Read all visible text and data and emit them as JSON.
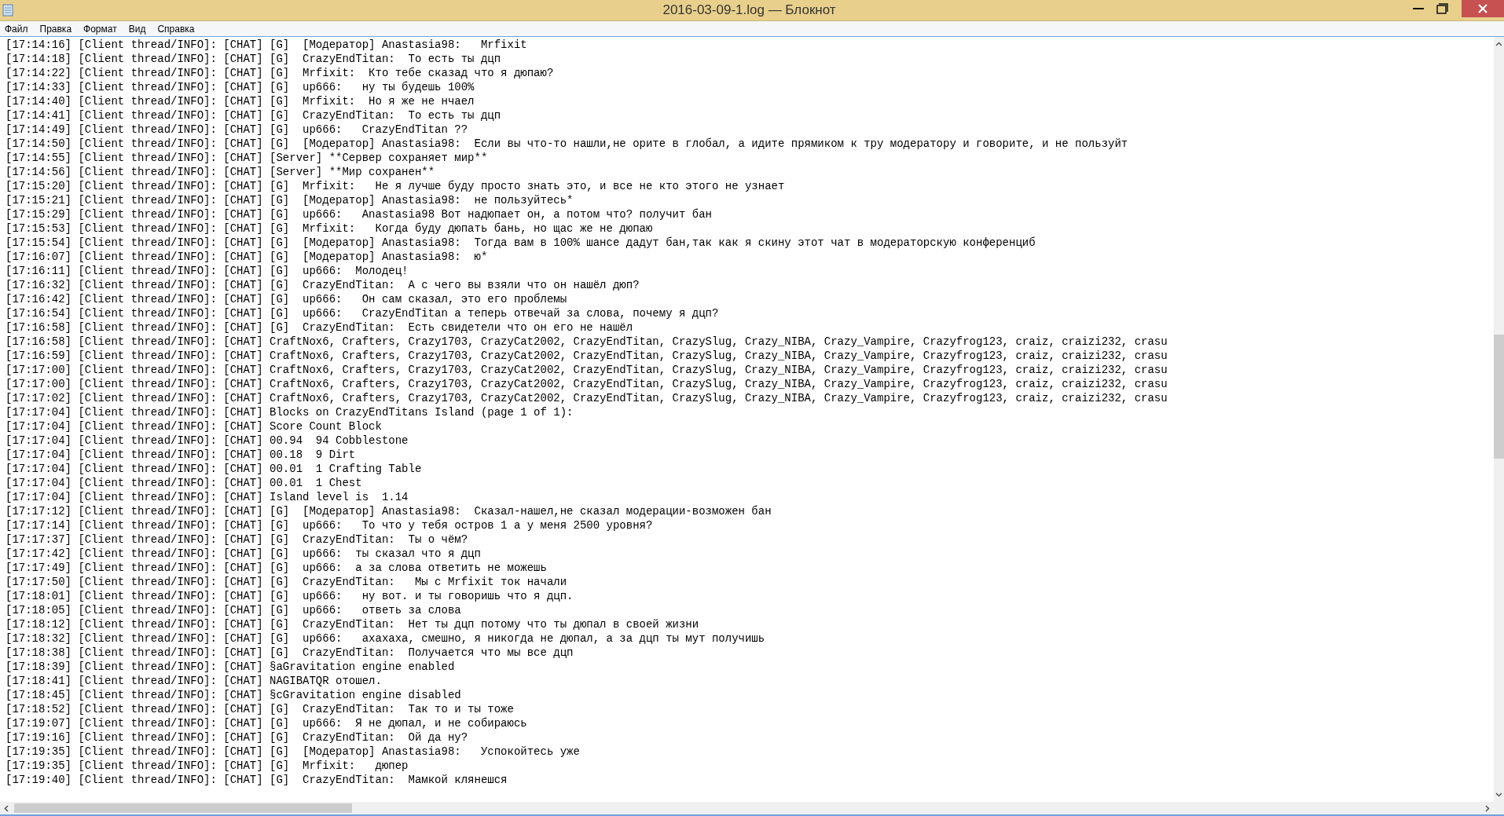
{
  "window": {
    "title": "2016-03-09-1.log — Блокнот"
  },
  "menu": [
    "Файл",
    "Правка",
    "Формат",
    "Вид",
    "Справка"
  ],
  "lines": [
    "[17:14:16] [Client thread/INFO]: [CHAT] [G]  [Модератор] Anastasia98:   Mrfixit",
    "[17:14:18] [Client thread/INFO]: [CHAT] [G]  CrazyEndTitan:  То есть ты дцп",
    "[17:14:22] [Client thread/INFO]: [CHAT] [G]  Mrfixit:  Кто тебе сказад что я дюпаю?",
    "[17:14:33] [Client thread/INFO]: [CHAT] [G]  up666:   ну ты будешь 100%",
    "[17:14:40] [Client thread/INFO]: [CHAT] [G]  Mrfixit:  Но я же не нчаел",
    "[17:14:41] [Client thread/INFO]: [CHAT] [G]  CrazyEndTitan:  То есть ты дцп",
    "[17:14:49] [Client thread/INFO]: [CHAT] [G]  up666:   CrazyEndTitan ??",
    "[17:14:50] [Client thread/INFO]: [CHAT] [G]  [Модератор] Anastasia98:  Если вы что-то нашли,не орите в глобал, а идите прямиком к тру модератору и говорите, и не пользуйт",
    "[17:14:55] [Client thread/INFO]: [CHAT] [Server] **Сервер сохраняет мир**",
    "[17:14:56] [Client thread/INFO]: [CHAT] [Server] **Мир сохранен**",
    "[17:15:20] [Client thread/INFO]: [CHAT] [G]  Mrfixit:   Не я лучше буду просто знать это, и все не кто этого не узнает",
    "[17:15:21] [Client thread/INFO]: [CHAT] [G]  [Модератор] Anastasia98:  не пользуйтесь*",
    "[17:15:29] [Client thread/INFO]: [CHAT] [G]  up666:   Anastasia98 Вот надюпает он, а потом что? получит бан",
    "[17:15:53] [Client thread/INFO]: [CHAT] [G]  Mrfixit:   Когда буду дюпать бань, но щас же не дюпаю",
    "[17:15:54] [Client thread/INFO]: [CHAT] [G]  [Модератор] Anastasia98:  Тогда вам в 100% шансе дадут бан,так как я скину этот чат в модераторскую конференциб",
    "[17:16:07] [Client thread/INFO]: [CHAT] [G]  [Модератор] Anastasia98:  ю*",
    "[17:16:11] [Client thread/INFO]: [CHAT] [G]  up666:  Молодец!",
    "[17:16:32] [Client thread/INFO]: [CHAT] [G]  CrazyEndTitan:  А с чего вы взяли что он нашёл дюп?",
    "[17:16:42] [Client thread/INFO]: [CHAT] [G]  up666:   Он сам сказал, это его проблемы",
    "[17:16:54] [Client thread/INFO]: [CHAT] [G]  up666:   CrazyEndTitan а теперь отвечай за слова, почему я дцп?",
    "[17:16:58] [Client thread/INFO]: [CHAT] [G]  CrazyEndTitan:  Есть свидетели что он его не нашёл",
    "[17:16:58] [Client thread/INFO]: [CHAT] CraftNox6, Crafters, Crazy1703, CrazyCat2002, CrazyEndTitan, CrazySlug, Crazy_NIBA, Crazy_Vampire, Crazyfrog123, craiz, craizi232, crasu",
    "[17:16:59] [Client thread/INFO]: [CHAT] CraftNox6, Crafters, Crazy1703, CrazyCat2002, CrazyEndTitan, CrazySlug, Crazy_NIBA, Crazy_Vampire, Crazyfrog123, craiz, craizi232, crasu",
    "[17:17:00] [Client thread/INFO]: [CHAT] CraftNox6, Crafters, Crazy1703, CrazyCat2002, CrazyEndTitan, CrazySlug, Crazy_NIBA, Crazy_Vampire, Crazyfrog123, craiz, craizi232, crasu",
    "[17:17:00] [Client thread/INFO]: [CHAT] CraftNox6, Crafters, Crazy1703, CrazyCat2002, CrazyEndTitan, CrazySlug, Crazy_NIBA, Crazy_Vampire, Crazyfrog123, craiz, craizi232, crasu",
    "[17:17:02] [Client thread/INFO]: [CHAT] CraftNox6, Crafters, Crazy1703, CrazyCat2002, CrazyEndTitan, CrazySlug, Crazy_NIBA, Crazy_Vampire, Crazyfrog123, craiz, craizi232, crasu",
    "[17:17:04] [Client thread/INFO]: [CHAT] Blocks on CrazyEndTitans Island (page 1 of 1):",
    "[17:17:04] [Client thread/INFO]: [CHAT] Score Count Block",
    "[17:17:04] [Client thread/INFO]: [CHAT] 00.94  94 Cobblestone",
    "[17:17:04] [Client thread/INFO]: [CHAT] 00.18  9 Dirt",
    "[17:17:04] [Client thread/INFO]: [CHAT] 00.01  1 Crafting Table",
    "[17:17:04] [Client thread/INFO]: [CHAT] 00.01  1 Chest",
    "[17:17:04] [Client thread/INFO]: [CHAT] Island level is  1.14",
    "[17:17:12] [Client thread/INFO]: [CHAT] [G]  [Модератор] Anastasia98:  Сказал-нашел,не сказал модерации-возможен бан",
    "[17:17:14] [Client thread/INFO]: [CHAT] [G]  up666:   То что у тебя остров 1 а у меня 2500 уровня?",
    "[17:17:37] [Client thread/INFO]: [CHAT] [G]  CrazyEndTitan:  Ты о чём?",
    "[17:17:42] [Client thread/INFO]: [CHAT] [G]  up666:  ты сказал что я дцп",
    "[17:17:49] [Client thread/INFO]: [CHAT] [G]  up666:  а за слова ответить не можешь",
    "[17:17:50] [Client thread/INFO]: [CHAT] [G]  CrazyEndTitan:   Мы с Mrfixit ток начали",
    "[17:18:01] [Client thread/INFO]: [CHAT] [G]  up666:   ну вот. и ты говоришь что я дцп.",
    "[17:18:05] [Client thread/INFO]: [CHAT] [G]  up666:   ответь за слова",
    "[17:18:12] [Client thread/INFO]: [CHAT] [G]  CrazyEndTitan:  Нет ты дцп потому что ты дюпал в своей жизни",
    "[17:18:32] [Client thread/INFO]: [CHAT] [G]  up666:   ахахаха, смешно, я никогда не дюпал, а за дцп ты мут получишь",
    "[17:18:38] [Client thread/INFO]: [CHAT] [G]  CrazyEndTitan:  Получается что мы все дцп",
    "[17:18:39] [Client thread/INFO]: [CHAT] §aGravitation engine enabled",
    "[17:18:41] [Client thread/INFO]: [CHAT] NAGIBATQR отошел.",
    "[17:18:45] [Client thread/INFO]: [CHAT] §cGravitation engine disabled",
    "[17:18:52] [Client thread/INFO]: [CHAT] [G]  CrazyEndTitan:  Так то и ты тоже",
    "[17:19:07] [Client thread/INFO]: [CHAT] [G]  up666:  Я не дюпал, и не собираюсь",
    "[17:19:16] [Client thread/INFO]: [CHAT] [G]  CrazyEndTitan:  Ой да ну?",
    "[17:19:35] [Client thread/INFO]: [CHAT] [G]  [Модератор] Anastasia98:   Успокойтесь уже",
    "[17:19:35] [Client thread/INFO]: [CHAT] [G]  Mrfixit:   дюпер",
    "[17:19:40] [Client thread/INFO]: [CHAT] [G]  CrazyEndTitan:  Мамкой клянешся"
  ]
}
